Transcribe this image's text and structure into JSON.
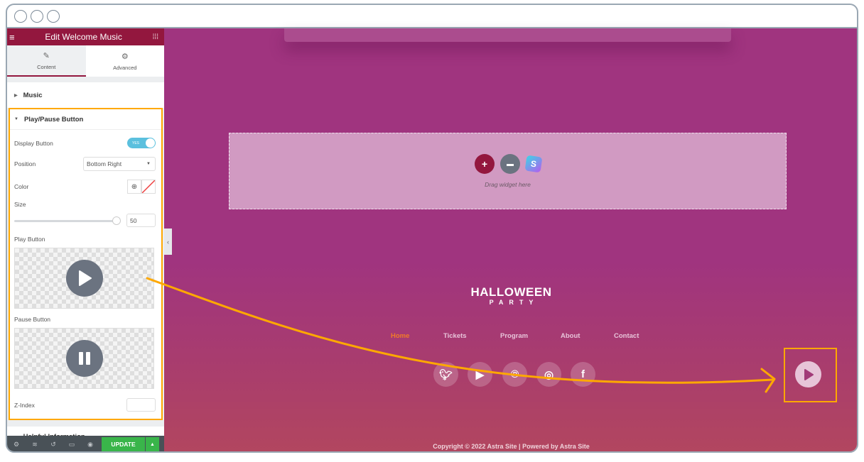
{
  "window": {
    "controls": [
      "close",
      "minimize",
      "maximize"
    ]
  },
  "panel": {
    "title": "Edit Welcome Music",
    "tabs": [
      {
        "label": "Content",
        "icon": "pencil-icon",
        "active": true
      },
      {
        "label": "Advanced",
        "icon": "gear-icon",
        "active": false
      }
    ],
    "sections": {
      "music": "Music",
      "play_pause": "Play/Pause Button",
      "helpful": "Helpful Information"
    },
    "controls": {
      "display_button": {
        "label": "Display Button",
        "toggle_text": "YES",
        "value": true
      },
      "position": {
        "label": "Position",
        "value": "Bottom Right"
      },
      "color": {
        "label": "Color"
      },
      "size": {
        "label": "Size",
        "value": "50",
        "slider_fraction": 1.0
      },
      "play_button": {
        "label": "Play Button"
      },
      "pause_button": {
        "label": "Pause Button"
      },
      "z_index": {
        "label": "Z-Index",
        "value": ""
      }
    },
    "footer": {
      "icons": [
        "settings-icon",
        "layers-icon",
        "history-icon",
        "responsive-icon",
        "preview-icon"
      ],
      "update_label": "UPDATE"
    }
  },
  "canvas": {
    "dropzone": {
      "label": "Drag widget here"
    },
    "logo": {
      "line1": "HALLOWEEN",
      "line2": "PARTY"
    },
    "nav": [
      {
        "label": "Home",
        "active": true
      },
      {
        "label": "Tickets",
        "active": false
      },
      {
        "label": "Program",
        "active": false
      },
      {
        "label": "About",
        "active": false
      },
      {
        "label": "Contact",
        "active": false
      }
    ],
    "social": [
      "twitter",
      "youtube",
      "pinterest",
      "instagram",
      "facebook"
    ],
    "copyright": "Copyright © 2022 Astra Site | Powered by Astra Site"
  },
  "colors": {
    "brand": "#93173e",
    "highlight": "#ffa800",
    "canvas_bg": "#a0347f",
    "update_green": "#39b54a",
    "nav_active": "#f07a28"
  }
}
